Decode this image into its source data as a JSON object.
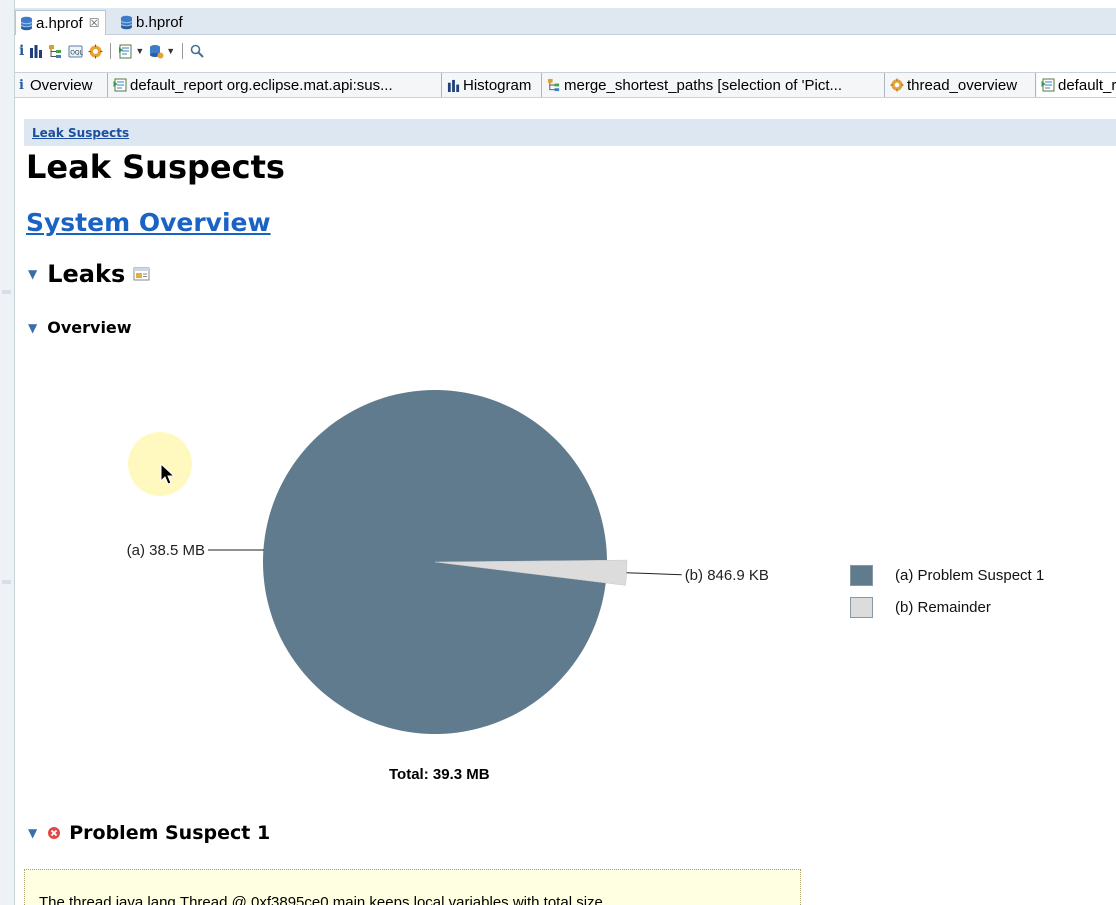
{
  "editor_tabs": [
    {
      "label": "a.hprof",
      "icon": "heap-dump-icon",
      "close": "☒"
    },
    {
      "label": "b.hprof",
      "icon": "heap-dump-icon"
    }
  ],
  "toolbar": {
    "buttons": [
      "overview-icon",
      "histogram-icon",
      "dominator-tree-icon",
      "oql-icon",
      "thread-overview-icon",
      "reports-icon",
      "query-browser-icon",
      "search-icon"
    ]
  },
  "query_tabs": [
    {
      "icon": "info-icon",
      "label": "Overview"
    },
    {
      "icon": "report-icon",
      "label": "default_report  org.eclipse.mat.api:sus..."
    },
    {
      "icon": "histogram-icon",
      "label": "Histogram"
    },
    {
      "icon": "paths-icon",
      "label": "merge_shortest_paths  [selection of 'Pict..."
    },
    {
      "icon": "thread-icon",
      "label": "thread_overview"
    },
    {
      "icon": "report-icon",
      "label": "default_r"
    }
  ],
  "report": {
    "breadcrumb": "Leak Suspects",
    "title": "Leak Suspects",
    "system_overview_link": "System Overview",
    "leaks_heading": "Leaks",
    "overview_heading": "Overview",
    "problem_heading": "Problem Suspect 1",
    "suspect_text_preview": "The thread java.lang.Thread @ 0xf3895ce0 main keeps local variables with total size"
  },
  "chart_data": {
    "type": "pie",
    "slices": [
      {
        "key": "a",
        "label": "(a)  38.5 MB",
        "value_mb": 38.5,
        "legend": "(a)  Problem Suspect 1",
        "color": "#5f7b8d"
      },
      {
        "key": "b",
        "label": "(b)  846.9 KB",
        "value_mb": 0.8269,
        "legend": "(b)  Remainder",
        "color": "#dcdcdc"
      }
    ],
    "total": "Total: 39.3 MB",
    "legend_position": "right"
  },
  "colors": {
    "accent_link": "#1a63c4",
    "breadcrumb_bar": "#dde7f1",
    "suspect_box_bg": "#ffffe1"
  }
}
